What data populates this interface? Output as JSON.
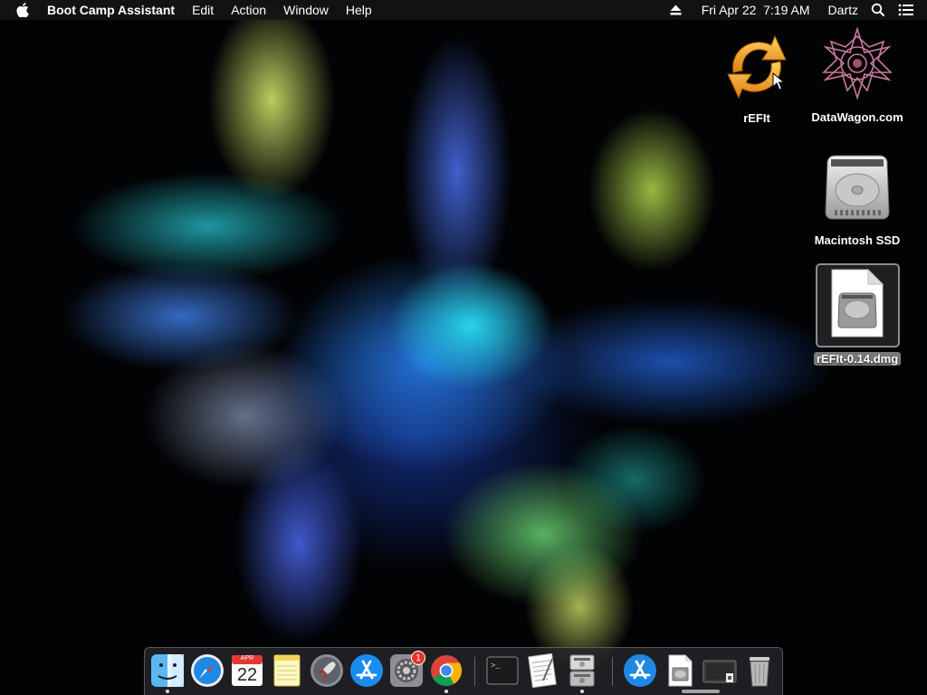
{
  "menubar": {
    "app_name": "Boot Camp Assistant",
    "menus": [
      "Edit",
      "Action",
      "Window",
      "Help"
    ],
    "clock": "Fri Apr 22  7:19 AM",
    "user": "Dartz",
    "icons": [
      "apple-icon",
      "eject-icon",
      "search-icon",
      "list-icon"
    ]
  },
  "desktop": {
    "icons": [
      {
        "label": "rEFIt",
        "icon": "refit-arrows-icon"
      },
      {
        "label": "DataWagon.com",
        "icon": "datawagon-star-icon"
      },
      {
        "label": "Macintosh SSD",
        "icon": "hard-drive-icon"
      },
      {
        "label": "rEFIt-0.14.dmg",
        "icon": "disk-image-icon",
        "selected": true
      }
    ]
  },
  "dock": {
    "apps": [
      {
        "name": "Finder",
        "icon": "finder-icon",
        "running": true
      },
      {
        "name": "Safari",
        "icon": "safari-icon",
        "running": false
      },
      {
        "name": "Calendar",
        "icon": "calendar-icon",
        "running": false,
        "month": "APR",
        "day": "22"
      },
      {
        "name": "Notes",
        "icon": "notes-icon",
        "running": false
      },
      {
        "name": "Launchpad",
        "icon": "launchpad-icon",
        "running": false
      },
      {
        "name": "App Store",
        "icon": "app-store-icon",
        "running": false
      },
      {
        "name": "System Preferences",
        "icon": "system-preferences-icon",
        "running": false,
        "badge": "1"
      },
      {
        "name": "Chrome",
        "icon": "chrome-icon",
        "running": true
      },
      {
        "name": "Terminal",
        "icon": "terminal-icon",
        "running": false
      },
      {
        "name": "TextEdit",
        "icon": "textedit-icon",
        "running": false
      },
      {
        "name": "Boot Camp Assistant",
        "icon": "boot-camp-icon",
        "running": true
      },
      {
        "name": "Applications",
        "icon": "applications-folder-icon",
        "running": false
      },
      {
        "name": "rEFIt-0.14.dmg",
        "icon": "dmg-document-icon",
        "running": false
      },
      {
        "name": "Screen",
        "icon": "screenshot-icon",
        "running": false
      },
      {
        "name": "Trash",
        "icon": "trash-icon",
        "running": false
      }
    ]
  },
  "colors": {
    "menubar_bg": "#141416",
    "badge_red": "#e8342c",
    "refit_orange": "#f0a020",
    "selection_gray": "#7a7a7e"
  }
}
